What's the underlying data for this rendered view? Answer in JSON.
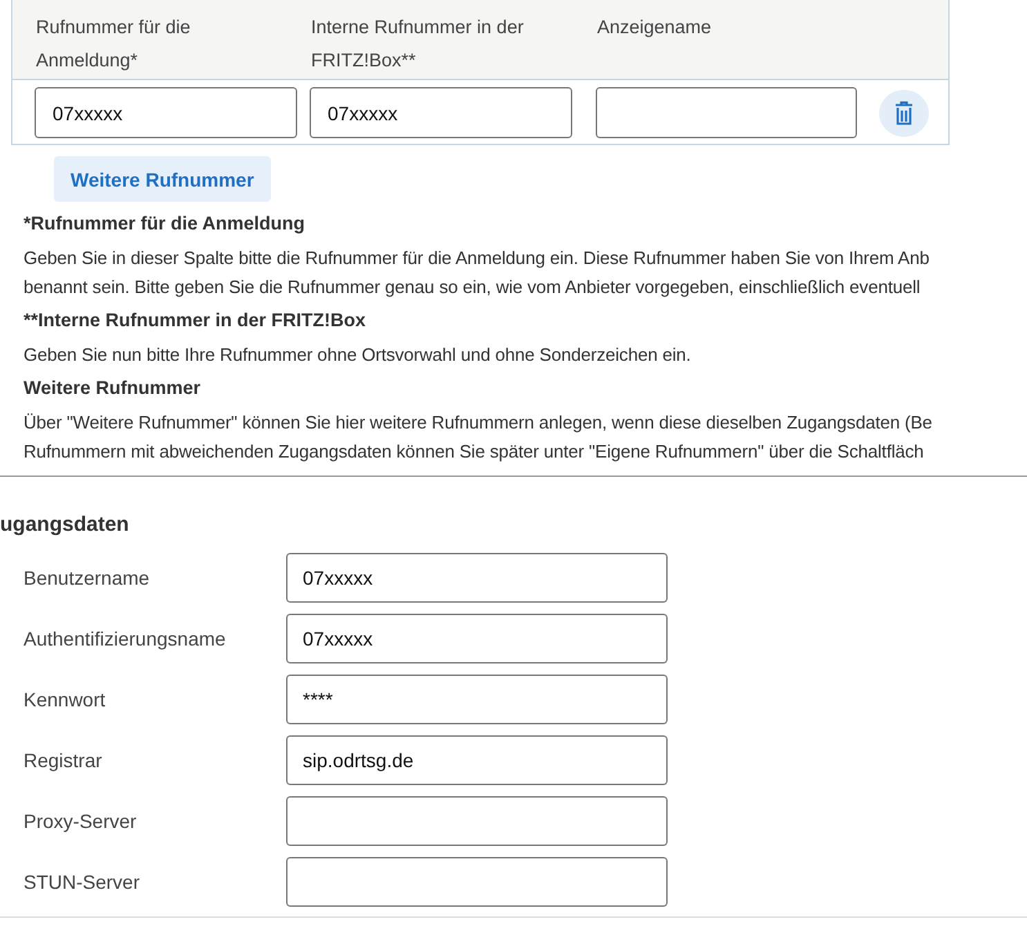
{
  "numbers_table": {
    "columns": [
      "Rufnummer für die Anmeldung*",
      "Interne Rufnummer in der FRITZ!Box**",
      "Anzeigename"
    ],
    "rows": [
      {
        "cells": [
          {
            "value": "07xxxxx"
          },
          {
            "value": "07xxxxx"
          },
          {}
        ]
      }
    ]
  },
  "add_button": "Weitere Rufnummer",
  "notes": [
    {
      "heading": "*Rufnummer für die Anmeldung",
      "lines": [
        "Geben Sie in dieser Spalte bitte die Rufnummer für die Anmeldung ein. Diese Rufnummer haben Sie von Ihrem Anb",
        "benannt sein. Bitte geben Sie die Rufnummer genau so ein, wie vom Anbieter vorgegeben, einschließlich eventuell"
      ]
    },
    {
      "heading": "**Interne Rufnummer in der FRITZ!Box",
      "lines": [
        "Geben Sie nun bitte Ihre Rufnummer ohne Ortsvorwahl und ohne Sonderzeichen ein."
      ]
    },
    {
      "heading": "Weitere Rufnummer",
      "lines": [
        "Über \"Weitere Rufnummer\" können Sie hier weitere Rufnummern anlegen, wenn diese dieselben Zugangsdaten (Be",
        "Rufnummern mit abweichenden Zugangsdaten können Sie später unter \"Eigene Rufnummern\" über die Schaltfläch"
      ]
    }
  ],
  "access": {
    "title": "ugangsdaten",
    "fields": [
      {
        "label": "Benutzername",
        "value": "07xxxxx"
      },
      {
        "label": "Authentifizierungsname",
        "value": "07xxxxx"
      },
      {
        "label": "Kennwort",
        "value": "****"
      },
      {
        "label": "Registrar",
        "value": "sip.odrtsg.de"
      },
      {
        "label": "Proxy-Server"
      },
      {
        "label": "STUN-Server"
      }
    ]
  }
}
